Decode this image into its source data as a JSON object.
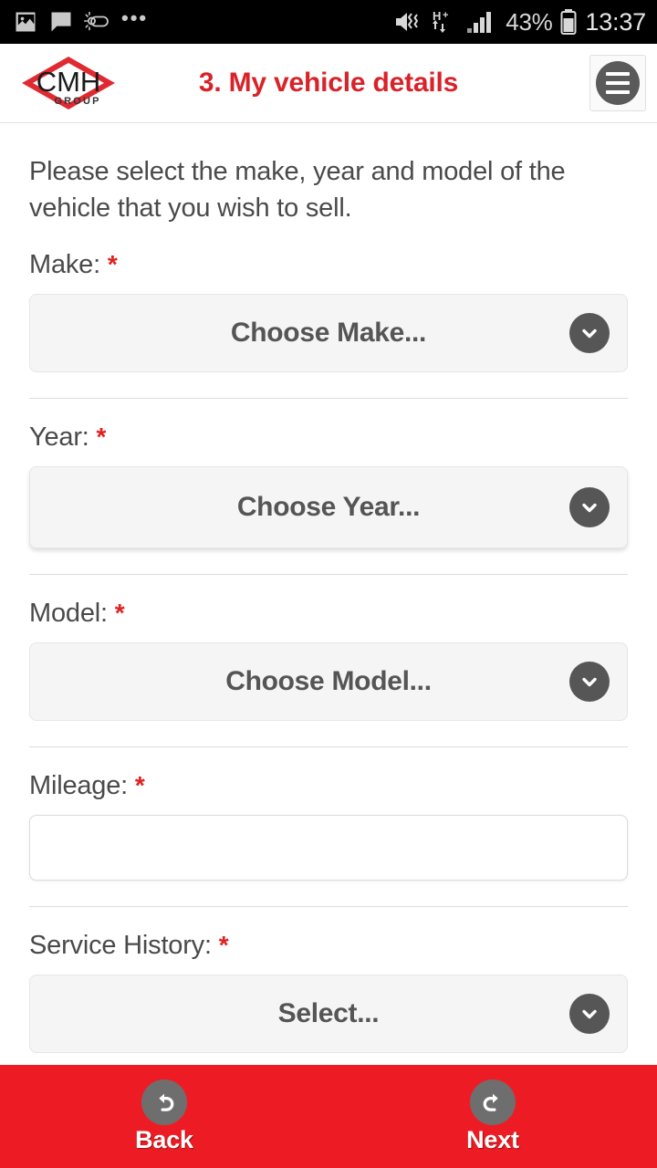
{
  "statusbar": {
    "left_icons": [
      "image-icon",
      "message-icon",
      "weather-icon",
      "more-dots-icon"
    ],
    "dots": "•••",
    "mute_icon": "mute-vibrate-icon",
    "network_type": "H+",
    "signal_icon": "signal-bars-icon",
    "battery_percent": "43%",
    "battery_icon": "battery-icon",
    "time": "13:37"
  },
  "header": {
    "logo_text": "CMH",
    "logo_sub": "GROUP",
    "title": "3. My vehicle details",
    "menu_icon": "hamburger-menu-icon"
  },
  "main": {
    "intro": "Please select the make, year and model of the vehicle that you wish to sell.",
    "fields": [
      {
        "label": "Make:",
        "required": "*",
        "type": "select",
        "value": "Choose Make...",
        "raised": false
      },
      {
        "label": "Year:",
        "required": "*",
        "type": "select",
        "value": "Choose Year...",
        "raised": true
      },
      {
        "label": "Model:",
        "required": "*",
        "type": "select",
        "value": "Choose Model...",
        "raised": false
      },
      {
        "label": "Mileage:",
        "required": "*",
        "type": "text",
        "value": "",
        "placeholder": ""
      },
      {
        "label": "Service History:",
        "required": "*",
        "type": "select",
        "value": "Select...",
        "raised": false
      }
    ]
  },
  "footer": {
    "back_label": "Back",
    "back_icon": "undo-arrow-icon",
    "next_label": "Next",
    "next_icon": "redo-arrow-icon"
  },
  "colors": {
    "brand_red": "#d8232a",
    "footer_red": "#ed1c24",
    "required_red": "#e02020",
    "text_gray": "#4a4a4a",
    "control_gray": "#565656",
    "field_bg": "#f5f5f5"
  }
}
